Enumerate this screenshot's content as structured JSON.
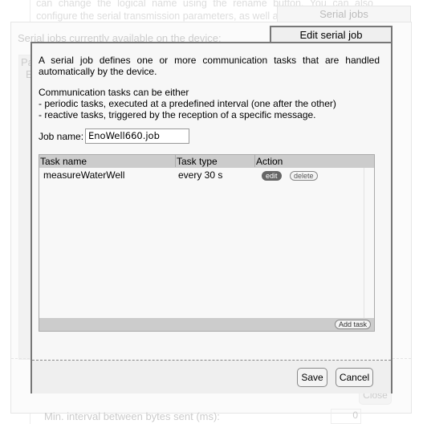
{
  "background": {
    "text": "can change the logical name using the rename button. You can also configure the serial transmission parameters, as well as",
    "footer_label": "Min. interval between bytes sent (ms):",
    "footer_value": "0"
  },
  "serial_jobs": {
    "title": "Serial jobs",
    "intro": "Serial jobs currently available on the device:",
    "table_header": "Pa",
    "table_row": "E",
    "close_label": "Close"
  },
  "edit_dialog": {
    "title": "Edit serial job",
    "intro": "A serial job defines one or more communication tasks that are handled automatically by the device.",
    "lines": [
      "Communication tasks can be either",
      "- periodic tasks, executed at a predefined interval (one after the other)",
      "- reactive tasks, triggered by the reception of a specific message."
    ],
    "job_name_label": "Job name:",
    "job_name_value": "EnoWell660.job",
    "columns": [
      "Task name",
      "Task type",
      "Action"
    ],
    "rows": [
      {
        "name": "measureWaterWell",
        "type": "every 30 s",
        "edit": "edit",
        "delete": "delete"
      }
    ],
    "add_task": "Add task",
    "save": "Save",
    "cancel": "Cancel"
  }
}
